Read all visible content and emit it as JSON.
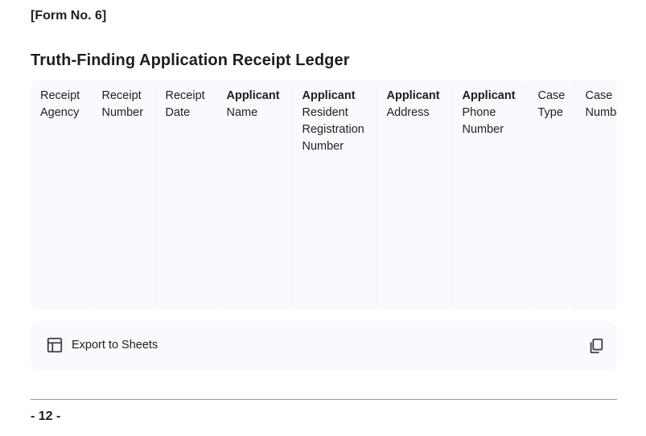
{
  "form_no": "[Form No. 6]",
  "title": "Truth-Finding Application Receipt Ledger",
  "table": {
    "columns": [
      {
        "bold": "",
        "rest": "Receipt Agency"
      },
      {
        "bold": "",
        "rest": "Receipt Number"
      },
      {
        "bold": "",
        "rest": "Receipt Date"
      },
      {
        "bold": "Applicant",
        "rest": "Name"
      },
      {
        "bold": "Applicant",
        "rest": "Resident Registration Number"
      },
      {
        "bold": "Applicant",
        "rest": "Address"
      },
      {
        "bold": "Applicant",
        "rest": "Phone Number"
      },
      {
        "bold": "",
        "rest": "Case Type"
      },
      {
        "bold": "",
        "rest": "Case Number"
      }
    ]
  },
  "export": {
    "label": "Export to Sheets",
    "icon": "table-icon",
    "copy_icon": "copy-icon"
  },
  "footer": {
    "page_number": "- 12 -"
  }
}
